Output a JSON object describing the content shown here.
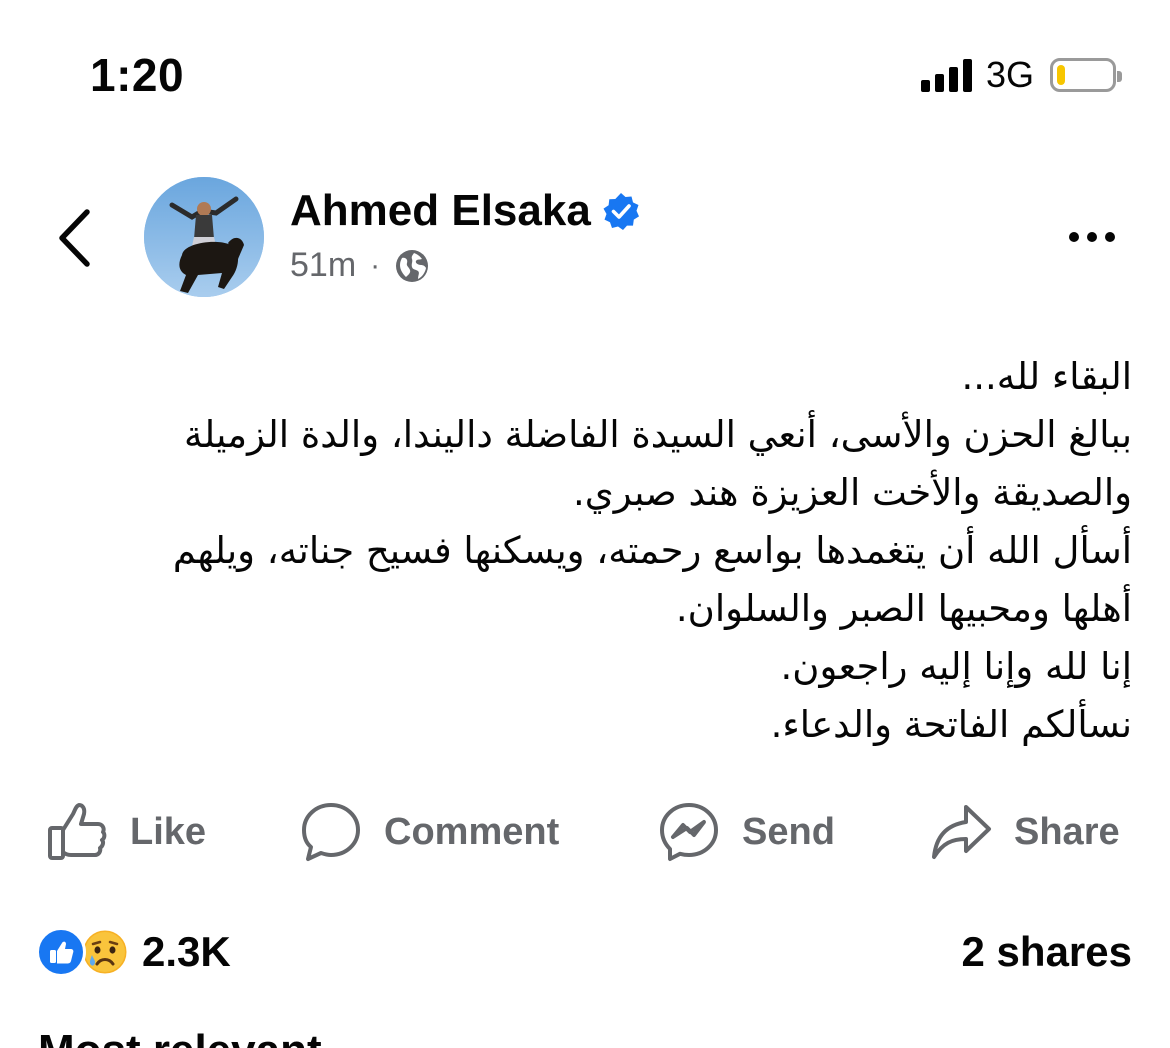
{
  "status_bar": {
    "time": "1:20",
    "network": "3G",
    "battery_level": 0.15
  },
  "post": {
    "author": "Ahmed Elsaka",
    "verified": true,
    "time_ago": "51m",
    "separator": "·",
    "audience_icon": "globe-icon",
    "body_lines": [
      "البقاء لله...",
      "ببالغ الحزن والأسى، أنعي السيدة الفاضلة داليندا، والدة الزميلة",
      "والصديقة والأخت العزيزة هند صبري.",
      "أسأل الله أن يتغمدها بواسع رحمته، ويسكنها فسيح جناته، ويلهم",
      "أهلها ومحبيها الصبر والسلوان.",
      "إنا لله وإنا إليه راجعون.",
      "نسألكم الفاتحة والدعاء."
    ]
  },
  "actions": {
    "like": "Like",
    "comment": "Comment",
    "send": "Send",
    "share": "Share"
  },
  "engagement": {
    "reactions": [
      "like",
      "sad"
    ],
    "reaction_count": "2.3K",
    "shares": "2 shares"
  },
  "comments": {
    "sort_label": "Most relevant"
  },
  "colors": {
    "accent": "#1877f2",
    "secondary_text": "#65676b",
    "primary_text": "#050505",
    "battery": "#f7c600"
  }
}
